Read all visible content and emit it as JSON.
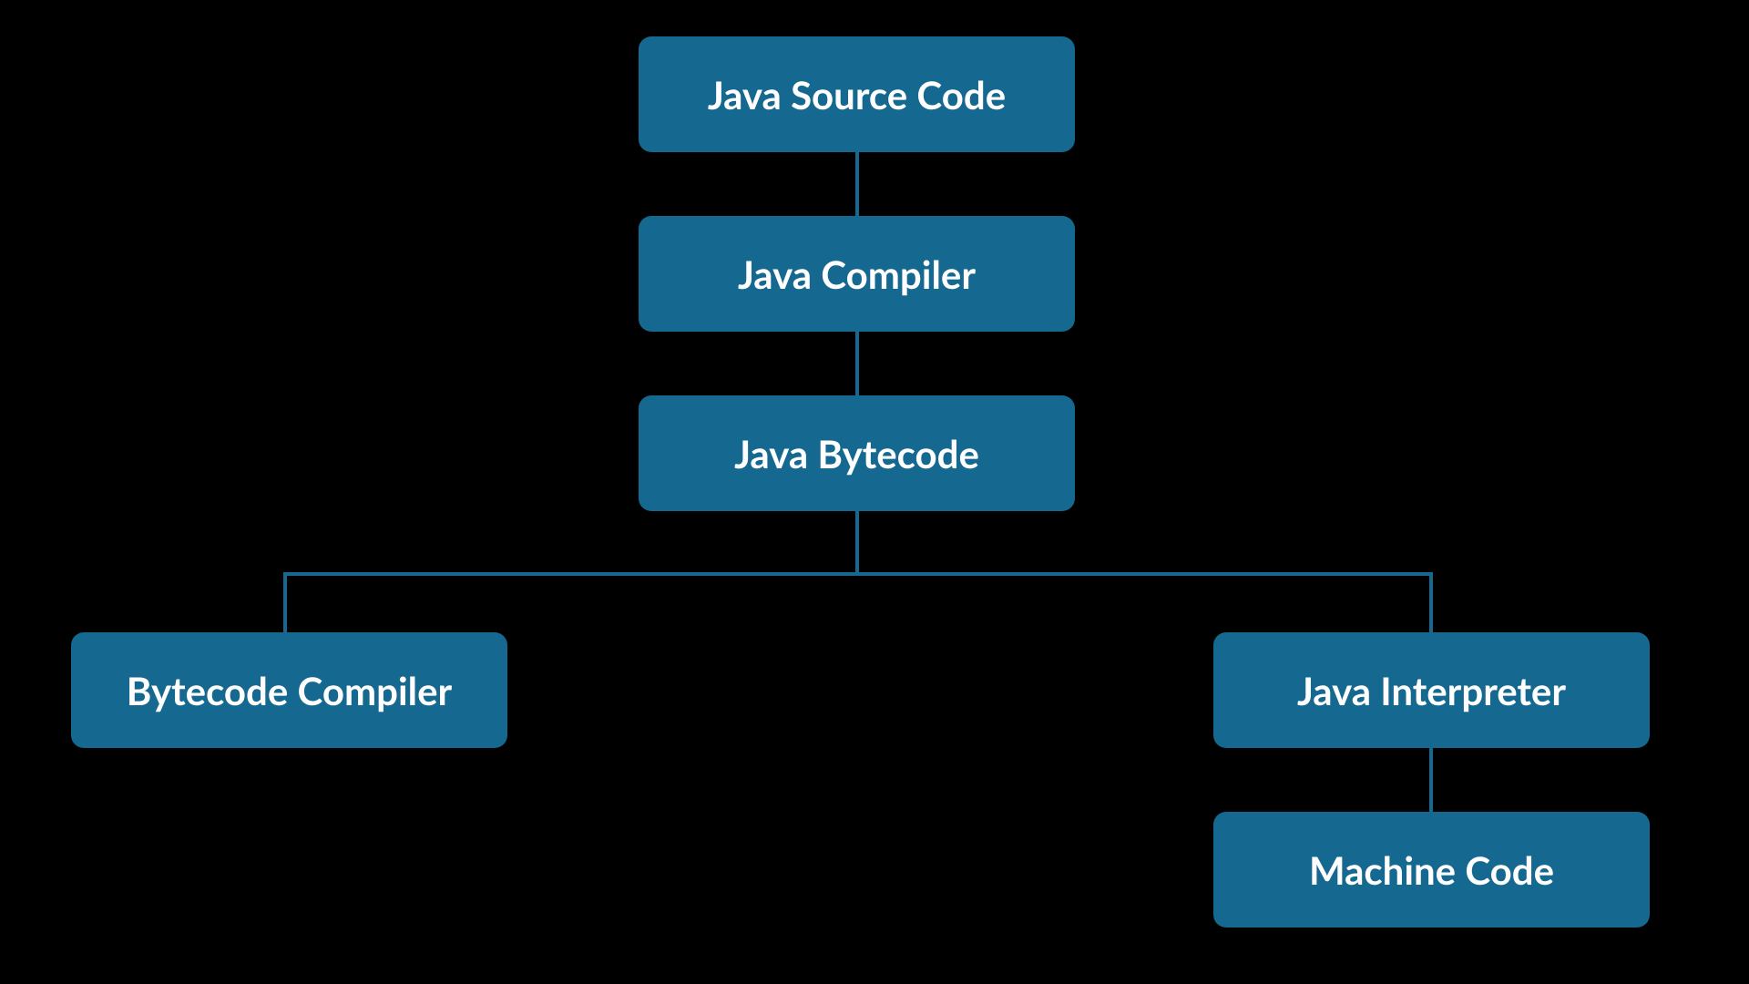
{
  "nodes": {
    "source": {
      "label": "Java Source Code"
    },
    "compiler": {
      "label": "Java Compiler"
    },
    "bytecode": {
      "label": "Java Bytecode"
    },
    "bccompiler": {
      "label": "Bytecode Compiler"
    },
    "interpreter": {
      "label": "Java Interpreter"
    },
    "machine": {
      "label": "Machine Code"
    }
  },
  "colors": {
    "node_bg": "#15688f",
    "node_fg": "#ffffff",
    "page_bg": "#000000"
  }
}
